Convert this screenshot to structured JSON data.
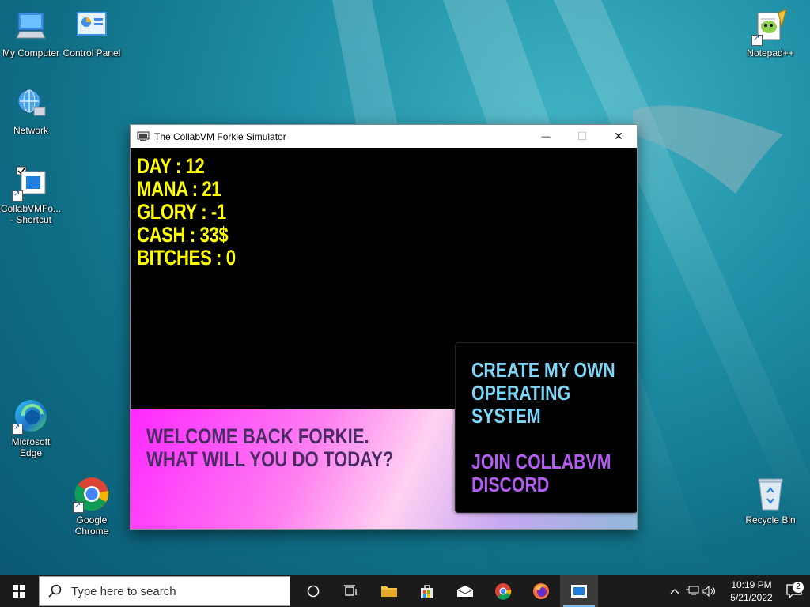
{
  "desktop": {
    "icons": [
      {
        "label": "My Computer",
        "icon": "computer-icon"
      },
      {
        "label": "Control Panel",
        "icon": "control-panel-icon"
      },
      {
        "label": "Network",
        "icon": "network-icon"
      },
      {
        "label": "CollabVMFo... - Shortcut",
        "icon": "app-window-icon"
      },
      {
        "label": "Microsoft Edge",
        "icon": "edge-icon"
      },
      {
        "label": "Google Chrome",
        "icon": "chrome-icon"
      },
      {
        "label": "Notepad++",
        "icon": "notepadpp-icon"
      },
      {
        "label": "Recycle Bin",
        "icon": "recycle-bin-icon"
      }
    ]
  },
  "window": {
    "title": "The CollabVM Forkie Simulator",
    "controls": {
      "minimize": "—",
      "maximize": "☐",
      "close": "✕"
    }
  },
  "game": {
    "stats": [
      "DAY : 12",
      "MANA : 21",
      "GLORY : -1",
      "CASH : 33$",
      "BITCHES : 0"
    ],
    "welcome_line1": "WELCOME BACK FORKIE.",
    "welcome_line2": "WHAT WILL YOU DO TODAY?",
    "menu": {
      "option1_line1": "CREATE MY OWN",
      "option1_line2": "OPERATING",
      "option1_line3": "SYSTEM",
      "option2_line1": "JOIN COLLABVM",
      "option2_line2": "DISCORD"
    },
    "colors": {
      "stats": "#ffff00",
      "option1": "#7dd6f7",
      "option2": "#b35cf2",
      "welcome": "#4b2a66"
    }
  },
  "taskbar": {
    "search_placeholder": "Type here to search",
    "clock_time": "10:19 PM",
    "clock_date": "5/21/2022",
    "notification_count": "2"
  }
}
